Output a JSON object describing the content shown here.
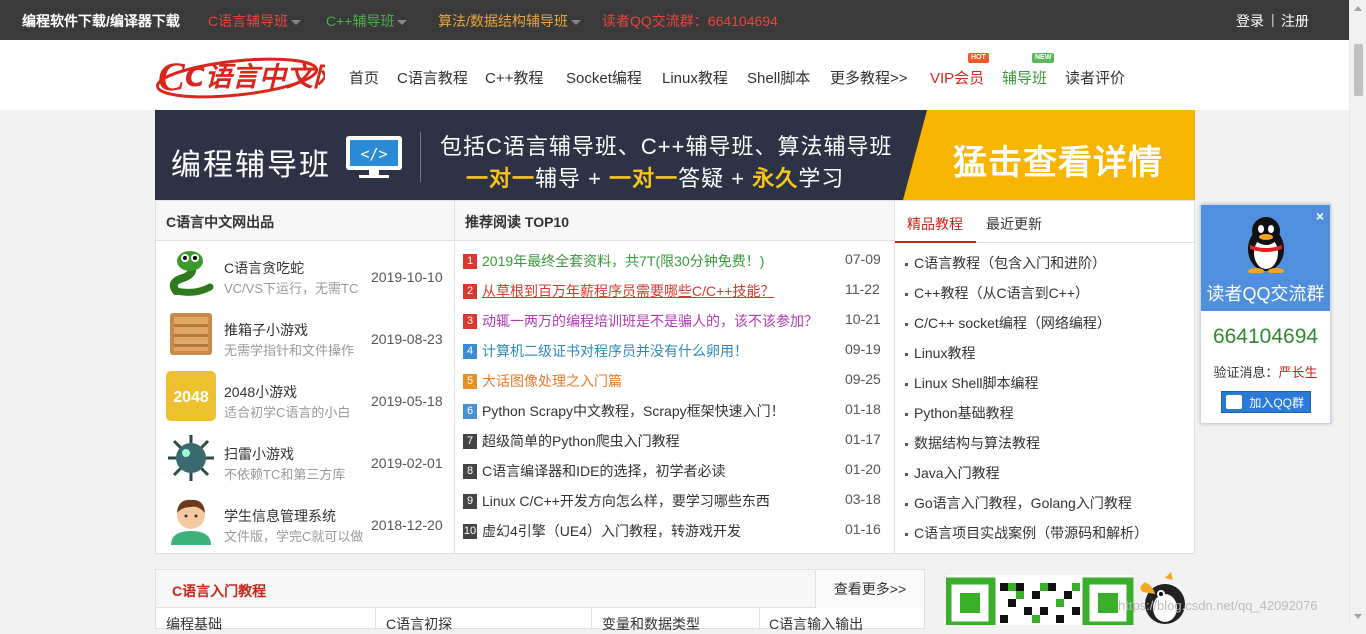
{
  "topbar": {
    "items": [
      {
        "label": "编程软件下载/编译器下载",
        "color": "#ffffff"
      },
      {
        "label": "C语言辅导班",
        "color": "#e8453c"
      },
      {
        "label": "C++辅导班",
        "color": "#4cae4c"
      },
      {
        "label": "算法/数据结构辅导班",
        "color": "#e8a33c"
      },
      {
        "label": "读者QQ交流群：664104694",
        "color": "#e8453c"
      }
    ],
    "login": "登录",
    "register": "注册",
    "sep": "|"
  },
  "logo": {
    "text": "C语言中文网"
  },
  "nav": {
    "items": [
      "首页",
      "C语言教程",
      "C++教程",
      "Socket编程",
      "Linux教程",
      "Shell脚本",
      "更多教程>>",
      "VIP会员",
      "辅导班",
      "读者评价"
    ],
    "vip_badge": "HOT",
    "tutor_badge": "NEW"
  },
  "banner": {
    "left": "编程辅导班",
    "line1": "包括C语言辅导班、C++辅导班、算法辅导班",
    "line2_a": "一对一",
    "line2_b": "辅导 + ",
    "line2_c": "一对一",
    "line2_d": "答疑 + ",
    "line2_e": "永久",
    "line2_f": "学习",
    "cta": "猛击查看详情"
  },
  "products": {
    "title": "C语言中文网出品",
    "items": [
      {
        "name": "C语言贪吃蛇",
        "desc": "VC/VS下运行，无需TC",
        "date": "2019-10-10"
      },
      {
        "name": "推箱子小游戏",
        "desc": "无需学指针和文件操作",
        "date": "2019-08-23"
      },
      {
        "name": "2048小游戏",
        "desc": "适合初学C语言的小白",
        "date": "2019-05-18",
        "icon_text": "2048"
      },
      {
        "name": "扫雷小游戏",
        "desc": "不依赖TC和第三方库",
        "date": "2019-02-01"
      },
      {
        "name": "学生信息管理系统",
        "desc": "文件版，学完C就可以做",
        "date": "2018-12-20"
      }
    ]
  },
  "recommend": {
    "title": "推荐阅读 TOP10",
    "items": [
      {
        "n": "1",
        "title": "2019年最终全套资料，共7T(限30分钟免费！)",
        "date": "07-09",
        "color": "#3a9a3a",
        "numc": "#d9382f"
      },
      {
        "n": "2",
        "title": "从草根到百万年薪程序员需要哪些C/C++技能？",
        "date": "11-22",
        "color": "#d9382f",
        "numc": "#d9382f",
        "u": true
      },
      {
        "n": "3",
        "title": "动辄一两万的编程培训班是不是骗人的，该不该参加？",
        "date": "10-21",
        "color": "#b03cb0",
        "numc": "#d9382f"
      },
      {
        "n": "4",
        "title": "计算机二级证书对程序员并没有什么卵用！",
        "date": "09-19",
        "color": "#2a8ab8",
        "numc": "#3a8fd0"
      },
      {
        "n": "5",
        "title": "大话图像处理之入门篇",
        "date": "09-25",
        "color": "#e87a2a",
        "numc": "#e8902a"
      },
      {
        "n": "6",
        "title": "Python Scrapy中文教程，Scrapy框架快速入门！",
        "date": "01-18",
        "color": "#333333",
        "numc": "#4a8fd0"
      },
      {
        "n": "7",
        "title": "超级简单的Python爬虫入门教程",
        "date": "01-17",
        "color": "#333333",
        "numc": "#444444"
      },
      {
        "n": "8",
        "title": "C语言编译器和IDE的选择，初学者必读",
        "date": "01-20",
        "color": "#333333",
        "numc": "#444444"
      },
      {
        "n": "9",
        "title": "Linux C/C++开发方向怎么样，要学习哪些东西",
        "date": "03-18",
        "color": "#333333",
        "numc": "#444444"
      },
      {
        "n": "10",
        "title": "虚幻4引擎（UE4）入门教程，转游戏开发",
        "date": "01-16",
        "color": "#333333",
        "numc": "#444444"
      }
    ]
  },
  "courses": {
    "tabs": [
      "精品教程",
      "最近更新"
    ],
    "items": [
      "C语言教程（包含入门和进阶）",
      "C++教程（从C语言到C++）",
      "C/C++ socket编程（网络编程）",
      "Linux教程",
      "Linux Shell脚本编程",
      "Python基础教程",
      "数据结构与算法教程",
      "Java入门教程",
      "Go语言入门教程，Golang入门教程",
      "C语言项目实战案例（带源码和解析）"
    ]
  },
  "qq": {
    "title": "读者QQ交流群",
    "number": "664104694",
    "verify_label": "验证消息：",
    "verify_value": "严长生",
    "join": "加入QQ群",
    "close": "×"
  },
  "section2": {
    "title": "C语言入门教程",
    "more": "查看更多>>",
    "cols": [
      "编程基础",
      "C语言初探",
      "变量和数据类型",
      "C语言输入输出"
    ]
  },
  "watermark": "https://blog.csdn.net/qq_42092076"
}
